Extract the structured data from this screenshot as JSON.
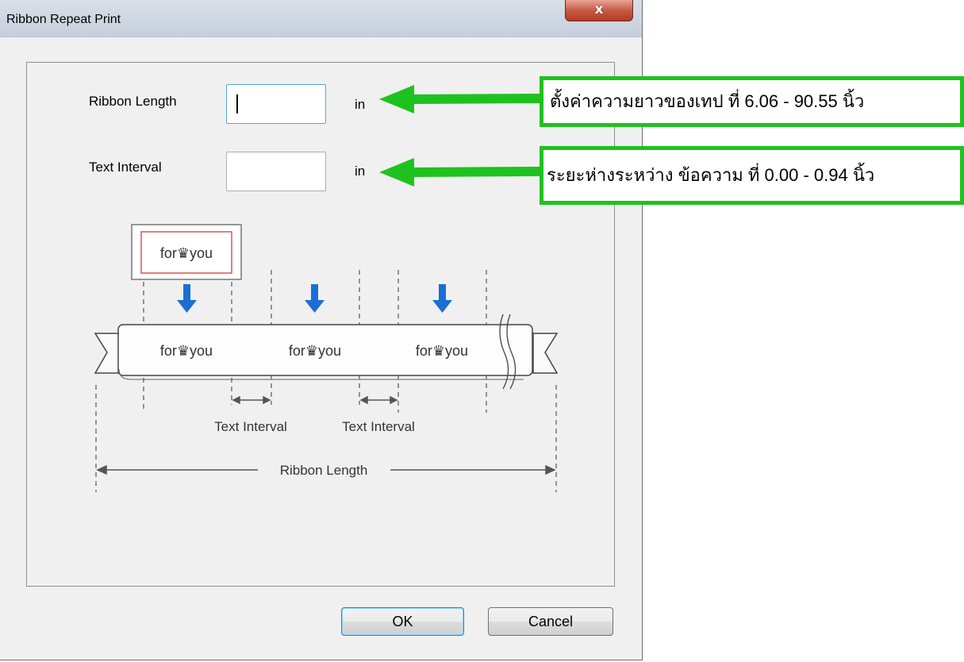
{
  "window": {
    "title": "Ribbon Repeat Print",
    "close_label": "x"
  },
  "form": {
    "ribbon_length": {
      "label": "Ribbon Length",
      "value": "",
      "unit": "in"
    },
    "text_interval": {
      "label": "Text Interval",
      "value": "",
      "unit": "in"
    }
  },
  "diagram": {
    "sample_text": "for♛you",
    "interval_label_1": "Text Interval",
    "interval_label_2": "Text Interval",
    "ribbon_length_label": "Ribbon Length"
  },
  "buttons": {
    "ok": "OK",
    "cancel": "Cancel"
  },
  "annotations": {
    "ribbon_length_note": "ตั้งค่าความยาวของเทป ที่ 6.06 - 90.55 นิ้ว",
    "text_interval_note": "ระยะห่างระหว่าง ข้อความ ที่ 0.00 - 0.94 นิ้ว"
  },
  "colors": {
    "annotation_green": "#1ec21e",
    "down_arrow_blue": "#1a6fd4",
    "sample_border_red": "#e05050"
  }
}
